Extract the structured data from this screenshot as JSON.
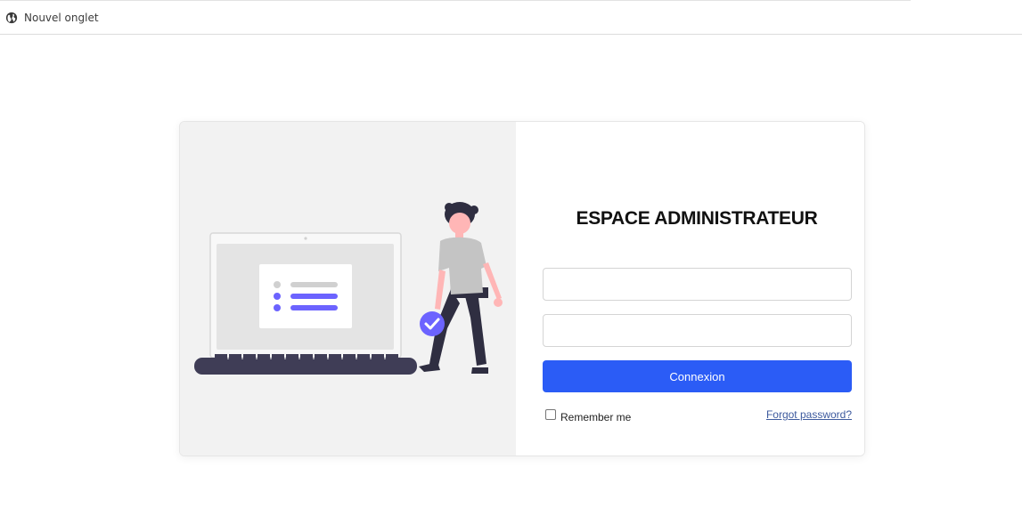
{
  "browser": {
    "tab_title": "Nouvel onglet",
    "tab_icon": "globe-icon"
  },
  "login": {
    "title": "ESPACE ADMINISTRATEUR",
    "username": {
      "value": "",
      "placeholder": ""
    },
    "password": {
      "value": "",
      "placeholder": ""
    },
    "submit_label": "Connexion",
    "remember_label": "Remember me",
    "remember_checked": false,
    "forgot_label": "Forgot password?"
  },
  "colors": {
    "accent": "#2b5cf6",
    "illustration_accent": "#6c63ff",
    "panel_background": "#f2f2f2",
    "dark": "#2f2e41"
  }
}
